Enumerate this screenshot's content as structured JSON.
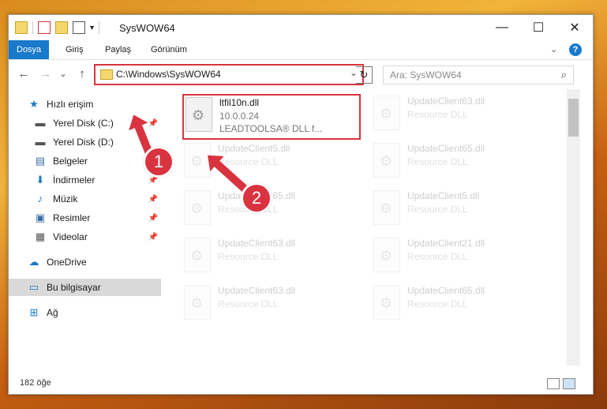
{
  "window": {
    "title": "SysWOW64",
    "minimize": "—",
    "maximize": "☐",
    "close": "✕"
  },
  "ribbon": {
    "tabs": [
      "Dosya",
      "Giriş",
      "Paylaş",
      "Görünüm"
    ],
    "collapse": "⌄",
    "help": "?"
  },
  "nav": {
    "back": "←",
    "forward": "→",
    "down": "⌄",
    "up": "↑",
    "address": "C:\\Windows\\SysWOW64",
    "address_drop": "⌄",
    "refresh": "↻",
    "search_placeholder": "Ara: SysWOW64"
  },
  "sidebar": {
    "items": [
      {
        "label": "Hızlı erişim",
        "icon": "★"
      },
      {
        "label": "Yerel Disk (C:)",
        "icon": "▬"
      },
      {
        "label": "Yerel Disk (D:)",
        "icon": "▬"
      },
      {
        "label": "Belgeler",
        "icon": "▤"
      },
      {
        "label": "İndirmeler",
        "icon": "⬇"
      },
      {
        "label": "Müzik",
        "icon": "♪"
      },
      {
        "label": "Resimler",
        "icon": "▣"
      },
      {
        "label": "Videolar",
        "icon": "▦"
      },
      {
        "label": "OneDrive",
        "icon": "☁"
      },
      {
        "label": "Bu bilgisayar",
        "icon": "▭"
      },
      {
        "label": "Ağ",
        "icon": "⊞"
      }
    ]
  },
  "files": [
    {
      "name": "ltfil10n.dll",
      "line2": "10.0.0.24",
      "line3": "LEADTOOLSA® DLL f..."
    },
    {
      "name": "UpdateClient63.dll",
      "line2": "Resource DLL"
    },
    {
      "name": "UpdateClient5.dll",
      "line2": "Resource DLL"
    },
    {
      "name": "UpdateClient65.dll",
      "line2": "Resource DLL"
    },
    {
      "name": "UpdateClient65.dll",
      "line2": "Resource DLL"
    },
    {
      "name": "UpdateClient5.dll",
      "line2": "Resource DLL"
    },
    {
      "name": "UpdateClient63.dll",
      "line2": "Resource DLL"
    },
    {
      "name": "UpdateClient21.dll",
      "line2": "Resource DLL"
    },
    {
      "name": "UpdateClient63.dll",
      "line2": "Resource DLL"
    },
    {
      "name": "UpdateClient65.dll",
      "line2": "Resource DLL"
    }
  ],
  "status": {
    "count": "182 öğe"
  },
  "callouts": [
    "1",
    "2"
  ],
  "colors": {
    "accent": "#1979ca",
    "highlight": "#d9333f"
  }
}
